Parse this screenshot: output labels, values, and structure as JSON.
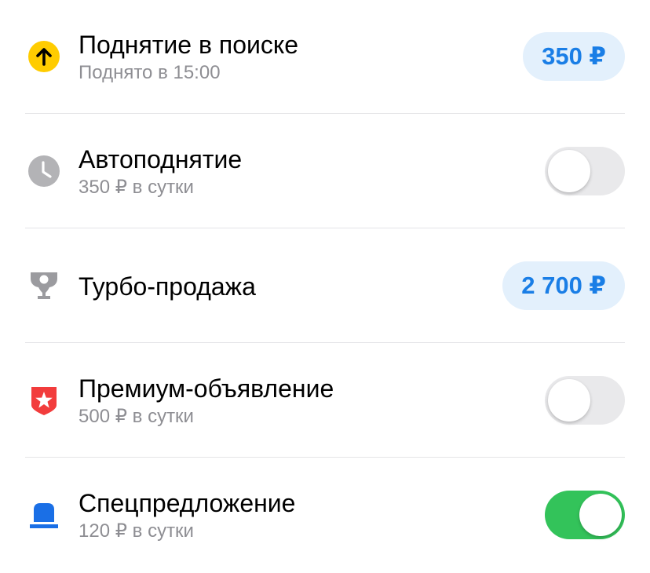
{
  "items": [
    {
      "title": "Поднятие в поиске",
      "subtitle": "Поднято в 15:00",
      "action": "price",
      "price": "350 ₽",
      "icon": "arrow-up-circle-icon",
      "icon_color": "#ffcc00"
    },
    {
      "title": "Автоподнятие",
      "subtitle": "350 ₽ в сутки",
      "action": "toggle",
      "toggle_on": false,
      "icon": "clock-icon",
      "icon_color": "#b3b3b6"
    },
    {
      "title": "Турбо-продажа",
      "subtitle": "",
      "action": "price",
      "price": "2 700 ₽",
      "icon": "trophy-icon",
      "icon_color": "#9b9b9f"
    },
    {
      "title": "Премиум-объявление",
      "subtitle": "500 ₽ в сутки",
      "action": "toggle",
      "toggle_on": false,
      "icon": "star-badge-icon",
      "icon_color": "#f23c3c"
    },
    {
      "title": "Спецпредложение",
      "subtitle": "120 ₽ в сутки",
      "action": "toggle",
      "toggle_on": true,
      "icon": "flashing-light-icon",
      "icon_color": "#1a6fe6"
    }
  ],
  "colors": {
    "price_background": "#e3f0fc",
    "price_text": "#1a7ee6",
    "toggle_on": "#33c35a",
    "toggle_off": "#e9e9eb",
    "subtitle": "#8e8e93"
  }
}
